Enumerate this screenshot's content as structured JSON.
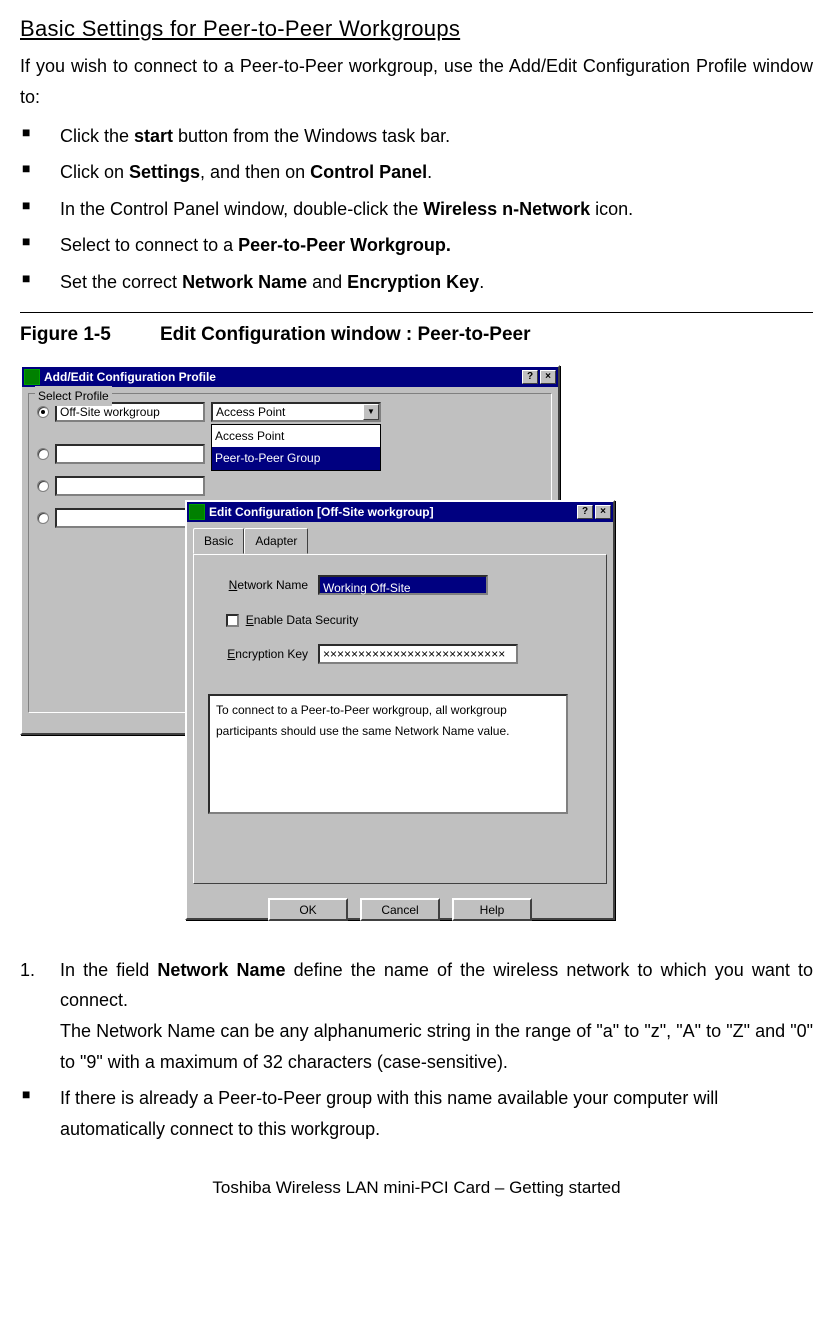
{
  "heading": "Basic Settings for Peer-to-Peer Workgroups",
  "intro": "If you wish to connect to a Peer-to-Peer workgroup, use the Add/Edit Configuration Profile window to:",
  "bullets": [
    {
      "pre": "Click the ",
      "bold": "start",
      "post": " button from the Windows task bar."
    },
    {
      "pre": "Click on ",
      "bold": "Settings",
      "post": ", and then on ",
      "bold2": "Control Panel",
      "post2": "."
    },
    {
      "pre": "In the Control Panel window, double-click the ",
      "bold": "Wireless n-Network",
      "post": " icon."
    },
    {
      "pre": "Select to connect to a ",
      "bold": "Peer-to-Peer Workgroup.",
      "post": ""
    },
    {
      "pre": "Set the correct ",
      "bold": "Network Name",
      "post": " and ",
      "bold2": "Encryption Key",
      "post2": "."
    }
  ],
  "figure": {
    "label": "Figure 1-5",
    "title": "Edit Configuration window : Peer-to-Peer"
  },
  "dialog1": {
    "title": "Add/Edit Configuration Profile",
    "group_label": "Select Profile",
    "profile_value": "Off-Site workgroup",
    "dropdown_value": "Access Point",
    "dropdown_options": [
      "Access Point",
      "Peer-to-Peer Group"
    ]
  },
  "dialog2": {
    "title": "Edit Configuration [Off-Site workgroup]",
    "tabs": [
      "Basic",
      "Adapter"
    ],
    "network_name_label": "Network Name",
    "network_name_value": "Working Off-Site",
    "enable_security_label": "Enable Data Security",
    "encryption_key_label": "Encryption Key",
    "encryption_key_value": "××××××××××××××××××××××××××",
    "msg": "To connect to a Peer-to-Peer workgroup, all workgroup participants should use the same Network Name value.",
    "buttons": [
      "OK",
      "Cancel",
      "Help"
    ]
  },
  "step1": {
    "num": "1.",
    "pre": "In the field ",
    "bold": "Network Name",
    "post": " define the name of the wireless network to which you want to connect.",
    "line2": "The Network Name can be any alphanumeric string in the range of  \"a\" to \"z\", \"A\" to \"Z\" and \"0\" to \"9\" with a maximum of 32 characters (case-sensitive)."
  },
  "step1_bullet": "If there is already a Peer-to-Peer group with this name available your computer will automatically connect to this workgroup.",
  "footer": "Toshiba Wireless LAN mini-PCI Card – Getting started"
}
